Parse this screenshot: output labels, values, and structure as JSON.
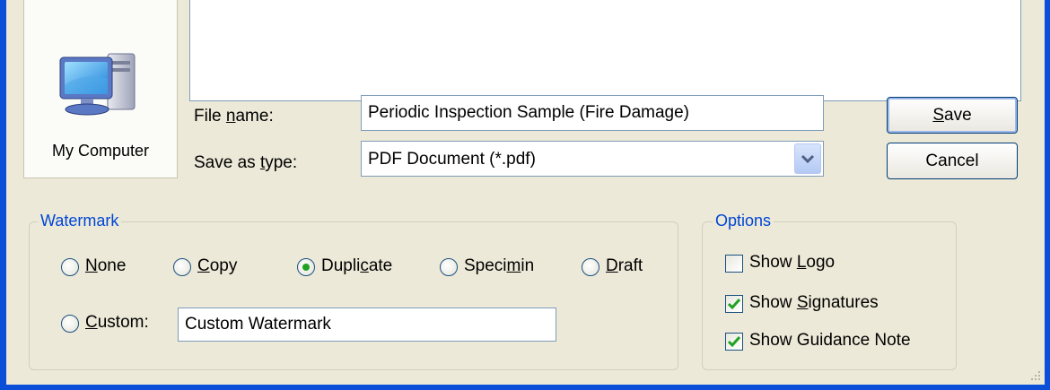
{
  "places_bar": {
    "my_computer_label": "My Computer"
  },
  "file_name": {
    "label_prefix": "File ",
    "label_accel": "n",
    "label_suffix": "ame:",
    "value": "Periodic Inspection Sample (Fire Damage)"
  },
  "save_as_type": {
    "label_prefix": "Save as ",
    "label_accel": "t",
    "label_suffix": "ype:",
    "value": "PDF Document (*.pdf)"
  },
  "buttons": {
    "save_accel": "S",
    "save_rest": "ave",
    "cancel": "Cancel"
  },
  "watermark": {
    "title": "Watermark",
    "options": [
      {
        "accel": "N",
        "rest": "one"
      },
      {
        "accel": "C",
        "rest": "opy"
      },
      {
        "pre": "Dupli",
        "accel": "c",
        "rest": "ate"
      },
      {
        "pre": "Speci",
        "accel": "m",
        "rest": "in"
      },
      {
        "accel": "D",
        "rest": "raft"
      }
    ],
    "custom": {
      "accel": "C",
      "rest": "ustom:",
      "value": "Custom Watermark"
    },
    "selected": "Duplicate"
  },
  "options": {
    "title": "Options",
    "items": [
      {
        "pre": "Show ",
        "accel": "L",
        "rest": "ogo",
        "checked": false
      },
      {
        "pre": "Show ",
        "accel": "S",
        "rest": "ignatures",
        "checked": true
      },
      {
        "pre": "Show Guidance Note",
        "accel": "",
        "rest": "",
        "checked": true
      }
    ]
  },
  "colors": {
    "frame": "#0b4fd9",
    "dialog_bg": "#ece9d8",
    "group_title": "#0046d5",
    "radio_dot": "#21a121",
    "check": "#21a121"
  }
}
